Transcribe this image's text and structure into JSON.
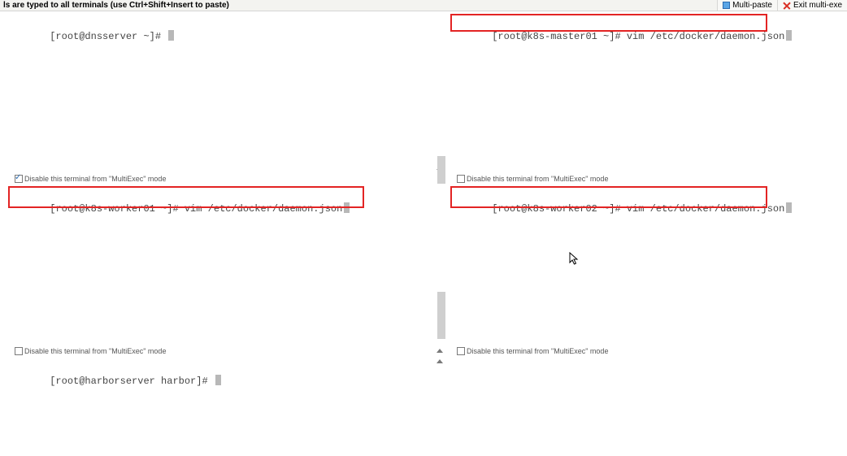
{
  "topbar": {
    "hint": "ls are typed to all terminals (use Ctrl+Shift+Insert to paste)",
    "multipaste_label": "Multi-paste",
    "exit_label": "Exit multi-exe"
  },
  "panes": {
    "tl": {
      "prompt": "[root@dnsserver ~]# ",
      "command": "",
      "disable_label": "Disable this terminal from \"MultiExec\" mode",
      "disable_checked": true
    },
    "tr": {
      "prompt": "[root@k8s-master01 ~]# ",
      "command": "vim /etc/docker/daemon.json",
      "disable_label": "Disable this terminal from \"MultiExec\" mode",
      "disable_checked": false
    },
    "ml": {
      "prompt": "[root@k8s-worker01 ~]# ",
      "command": "vim /etc/docker/daemon.json",
      "disable_label": "Disable this terminal from \"MultiExec\" mode",
      "disable_checked": false
    },
    "mr": {
      "prompt": "[root@k8s-worker02 ~]# ",
      "command": "vim /etc/docker/daemon.json",
      "disable_label": "Disable this terminal from \"MultiExec\" mode",
      "disable_checked": false
    },
    "bl": {
      "prompt": "[root@harborserver harbor]# ",
      "command": ""
    }
  }
}
